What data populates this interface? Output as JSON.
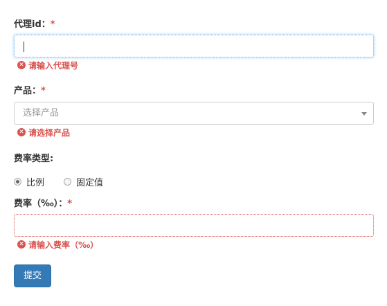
{
  "form": {
    "agent_id": {
      "label": "代理id：",
      "required_mark": "*",
      "value": "",
      "error": "请输入代理号"
    },
    "product": {
      "label": "产品：",
      "required_mark": "*",
      "placeholder": "选择产品",
      "error": "请选择产品"
    },
    "rate_type": {
      "label": "费率类型:",
      "options": [
        {
          "label": "比例",
          "checked": true
        },
        {
          "label": "固定值",
          "checked": false
        }
      ]
    },
    "rate": {
      "label": "费率（‰）：",
      "required_mark": "*",
      "value": "",
      "error": "请输入费率（‰）"
    },
    "submit_label": "提交"
  },
  "icons": {
    "error": "error-circle-icon",
    "dropdown": "chevron-down-icon"
  },
  "colors": {
    "required": "#d9534f",
    "error_text": "#d9534f",
    "focus_border": "#66afe9",
    "primary_button": "#337ab7",
    "label_text": "#333333",
    "placeholder_text": "#999999"
  }
}
